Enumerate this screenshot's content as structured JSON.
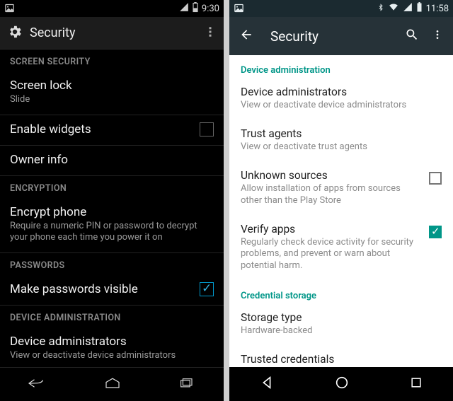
{
  "left": {
    "statusbar": {
      "time": "9:30"
    },
    "actionbar": {
      "title": "Security"
    },
    "sections": {
      "screen_security": "SCREEN SECURITY",
      "encryption": "ENCRYPTION",
      "passwords": "PASSWORDS",
      "device_admin": "DEVICE ADMINISTRATION"
    },
    "items": {
      "screen_lock": {
        "title": "Screen lock",
        "sub": "Slide"
      },
      "enable_widgets": {
        "title": "Enable widgets",
        "checked": false
      },
      "owner_info": {
        "title": "Owner info"
      },
      "encrypt_phone": {
        "title": "Encrypt phone",
        "sub": "Require a numeric PIN or password to decrypt your phone each time you power it on"
      },
      "make_pw_visible": {
        "title": "Make passwords visible",
        "checked": true
      },
      "device_admins": {
        "title": "Device administrators",
        "sub": "View or deactivate device administrators"
      }
    }
  },
  "right": {
    "statusbar": {
      "time": "11:58"
    },
    "actionbar": {
      "title": "Security"
    },
    "sections": {
      "device_admin": "Device administration",
      "cred_storage": "Credential storage"
    },
    "items": {
      "device_admins": {
        "title": "Device administrators",
        "sub": "View or deactivate device administrators"
      },
      "trust_agents": {
        "title": "Trust agents",
        "sub": "View or deactivate trust agents"
      },
      "unknown_sources": {
        "title": "Unknown sources",
        "sub": "Allow installation of apps from sources other than the Play Store",
        "checked": false
      },
      "verify_apps": {
        "title": "Verify apps",
        "sub": "Regularly check device activity for security problems, and prevent or warn about potential harm.",
        "checked": true
      },
      "storage_type": {
        "title": "Storage type",
        "sub": "Hardware-backed"
      },
      "trusted_creds": {
        "title": "Trusted credentials"
      }
    }
  }
}
